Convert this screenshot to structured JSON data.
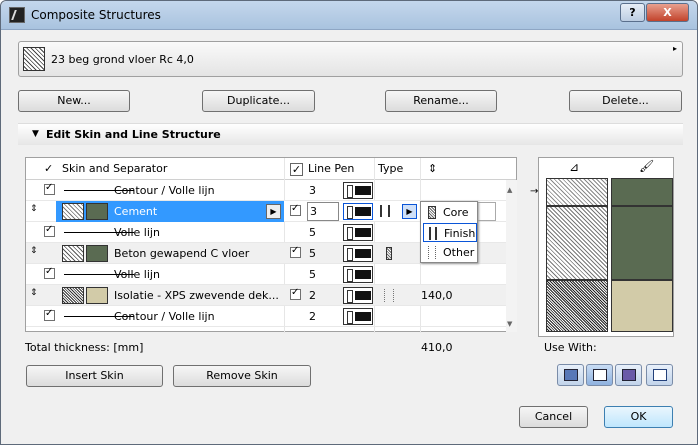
{
  "window": {
    "title": "Composite Structures",
    "help_label": "?",
    "close_label": "X"
  },
  "picker": {
    "name": "23 beg grond vloer Rc 4,0",
    "arrow": "▸"
  },
  "buttons": {
    "new": "New...",
    "duplicate": "Duplicate...",
    "rename": "Rename...",
    "delete": "Delete..."
  },
  "section": {
    "title": "Edit Skin and Line Structure",
    "arrow": "▼"
  },
  "table": {
    "headers": {
      "check": "✓",
      "skin": "Skin and Separator",
      "pen_check": "✓",
      "line_pen": "Line Pen",
      "type": "Type",
      "thickness": "⇕"
    },
    "rows": [
      {
        "kind": "separator",
        "name": "Contour / Volle lijn",
        "checked": true,
        "pen": "3"
      },
      {
        "kind": "skin",
        "name": "Cement",
        "pen_checked": true,
        "pen": "3",
        "color": "#5a6b52",
        "selected": true
      },
      {
        "kind": "separator",
        "name": "Volle lijn",
        "checked": true,
        "pen": "5"
      },
      {
        "kind": "skin",
        "name": "Beton gewapend C vloer",
        "pen_checked": true,
        "pen": "5",
        "color": "#5a6b52"
      },
      {
        "kind": "separator",
        "name": "Volle lijn",
        "checked": true,
        "pen": "5"
      },
      {
        "kind": "skin",
        "name": "Isolatie - XPS zwevende dek...",
        "pen_checked": true,
        "pen": "2",
        "thickness": "140,0",
        "color": "#d2cba8"
      },
      {
        "kind": "separator",
        "name": "Contour / Volle lijn",
        "checked": true,
        "pen": "2"
      }
    ]
  },
  "type_popup": {
    "items": [
      "Core",
      "Finish",
      "Other"
    ],
    "selected": "Finish"
  },
  "total": {
    "label": "Total thickness: [mm]",
    "value": "410,0"
  },
  "actions": {
    "insert_skin": "Insert Skin",
    "remove_skin": "Remove Skin"
  },
  "preview": {
    "use_with_label": "Use With:",
    "colors": {
      "dark_green": "#5a6b52",
      "beige": "#d2cba8"
    }
  },
  "footer": {
    "cancel": "Cancel",
    "ok": "OK"
  },
  "colors": {
    "selection": "#3399ff",
    "accent": "#0a55d8"
  }
}
